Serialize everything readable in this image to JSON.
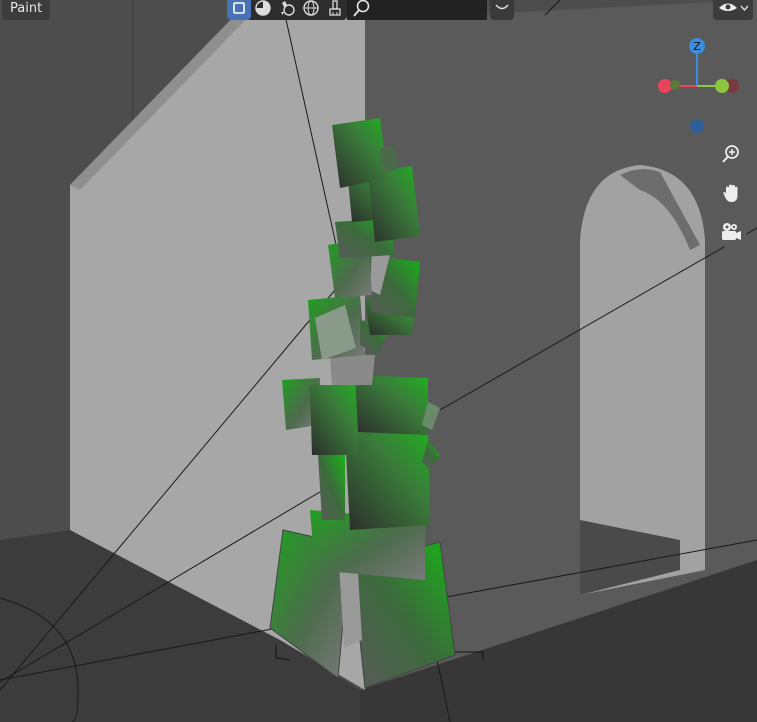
{
  "header": {
    "mode_label": "Paint"
  },
  "shading": {
    "modes": [
      {
        "icon": "solid-shading-icon",
        "active": true
      },
      {
        "icon": "material-preview-icon",
        "active": false
      },
      {
        "icon": "look-dev-icon",
        "active": false
      },
      {
        "icon": "rendered-shading-icon",
        "active": false
      },
      {
        "icon": "brush-icon",
        "active": false
      }
    ]
  },
  "search": {
    "icon": "search-icon"
  },
  "dropdown": {
    "icon": "chevron-down-icon"
  },
  "visibility": {
    "icon": "eye-icon"
  },
  "gizmo": {
    "z_label": "Z",
    "colors": {
      "x": "#e8455c",
      "y": "#8cc63f",
      "z": "#3b8de0"
    }
  },
  "nav": [
    {
      "icon": "zoom-icon"
    },
    {
      "icon": "hand-pan-icon"
    },
    {
      "icon": "camera-icon"
    }
  ],
  "colors": {
    "background": "#4a4a4a",
    "accent": "#4772b3",
    "paint_green": "#1fa01f"
  }
}
